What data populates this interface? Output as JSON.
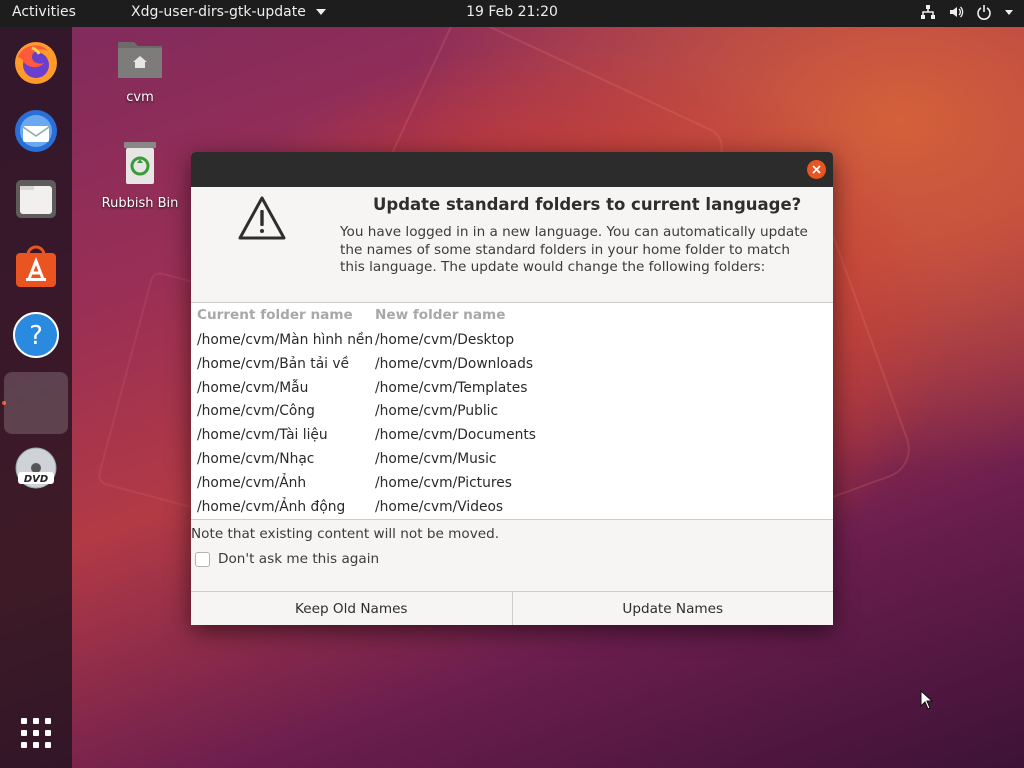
{
  "topbar": {
    "activities": "Activities",
    "app_menu": "Xdg-user-dirs-gtk-update",
    "clock": "19 Feb  21:20",
    "status_icons": [
      "network-icon",
      "volume-icon",
      "power-icon",
      "chevron-down-icon"
    ]
  },
  "dock": {
    "items": [
      {
        "name": "Firefox",
        "icon": "firefox-icon"
      },
      {
        "name": "Thunderbird",
        "icon": "thunderbird-icon"
      },
      {
        "name": "Files",
        "icon": "files-icon"
      },
      {
        "name": "Ubuntu Software",
        "icon": "software-icon"
      },
      {
        "name": "Help",
        "icon": "help-icon"
      },
      {
        "name": "Running app",
        "icon": "running-app-icon"
      },
      {
        "name": "DVD",
        "icon": "dvd-icon"
      }
    ],
    "show_apps_icon": "app-grid-icon"
  },
  "desktop": {
    "home_label": "cvm",
    "trash_label": "Rubbish Bin"
  },
  "dialog": {
    "heading": "Update standard folders to current language?",
    "body_lines": [
      "You have logged in in a new language. You can automatically update",
      "the names of some standard folders in your home folder to match",
      "this language. The update would change the following folders:"
    ],
    "table": {
      "headers": [
        "Current folder name",
        "New folder name"
      ],
      "rows": [
        [
          "/home/cvm/Màn hình nền",
          "/home/cvm/Desktop"
        ],
        [
          "/home/cvm/Bản tải về",
          "/home/cvm/Downloads"
        ],
        [
          "/home/cvm/Mẫu",
          "/home/cvm/Templates"
        ],
        [
          "/home/cvm/Công",
          "/home/cvm/Public"
        ],
        [
          "/home/cvm/Tài liệu",
          "/home/cvm/Documents"
        ],
        [
          "/home/cvm/Nhạc",
          "/home/cvm/Music"
        ],
        [
          "/home/cvm/Ảnh",
          "/home/cvm/Pictures"
        ],
        [
          "/home/cvm/Ảnh động",
          "/home/cvm/Videos"
        ]
      ]
    },
    "note": "Note that existing content will not be moved.",
    "checkbox_label": "Don't ask me this again",
    "checkbox_checked": false,
    "buttons": {
      "keep": "Keep Old Names",
      "update": "Update Names"
    }
  },
  "colors": {
    "accent": "#e95420",
    "titlebar": "#2c2c2c",
    "topbar": "#1d1d1d"
  }
}
